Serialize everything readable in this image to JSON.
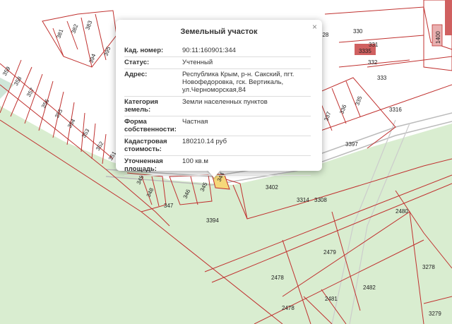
{
  "popup": {
    "title": "Земельный участок",
    "close_label": "×",
    "rows": [
      {
        "key": "Кад. номер:",
        "value": "90:11:160901:344"
      },
      {
        "key": "Статус:",
        "value": "Учтенный"
      },
      {
        "key": "Адрес:",
        "value": "Республика Крым, р-н. Сакский, пгт. Новофедоровка, гск. Вертикаль, ул.Черноморская,84"
      },
      {
        "key": "Категория земель:",
        "value": "Земли населенных пунктов"
      },
      {
        "key": "Форма собственности:",
        "value": "Частная"
      },
      {
        "key": "Кадастровая стоимость:",
        "value": "180210.14 руб"
      },
      {
        "key": "Уточненная площадь:",
        "value": "100 кв.м"
      }
    ]
  },
  "map": {
    "parcel_labels": [
      "381",
      "382",
      "383",
      "394",
      "395",
      "359",
      "358",
      "357",
      "356",
      "355",
      "354",
      "353",
      "352",
      "351",
      "349",
      "348",
      "347",
      "346",
      "345",
      "344",
      "428",
      "330",
      "331",
      "3335",
      "332",
      "333",
      "335",
      "336",
      "337",
      "3316",
      "3397",
      "3402",
      "3314",
      "3308",
      "3394",
      "2480",
      "2479",
      "2478",
      "2482",
      "2481",
      "3278",
      "3279",
      "1400"
    ],
    "colors": {
      "green_area": "#d9edd0",
      "boundary": "#c0312f",
      "selected": "#f5d87a",
      "building": "#d06060"
    }
  }
}
